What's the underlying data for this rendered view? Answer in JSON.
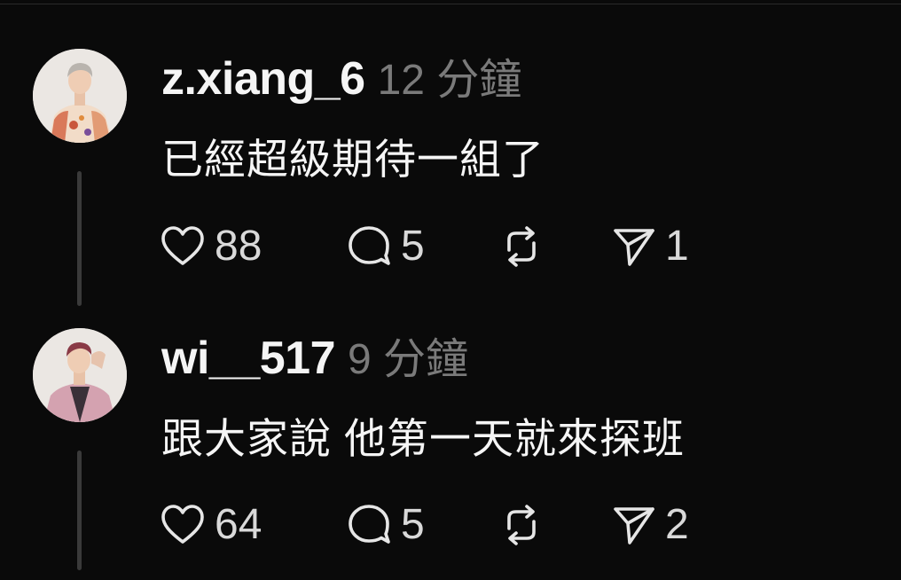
{
  "comments": [
    {
      "username": "z.xiang_6",
      "time": "12 分鐘",
      "text": "已經超級期待一組了",
      "likes": "88",
      "replies": "5",
      "shares": "1",
      "avatar_icon": "user-avatar-photo"
    },
    {
      "username": "wi__517",
      "time": "9 分鐘",
      "text": "跟大家說 他第一天就來探班",
      "likes": "64",
      "replies": "5",
      "shares": "2",
      "avatar_icon": "user-avatar-photo"
    }
  ],
  "icons": {
    "like": "heart-icon",
    "reply": "comment-bubble-icon",
    "repost": "repost-icon",
    "share": "send-icon"
  },
  "colors": {
    "background": "#0a0a0a",
    "text": "#f5f5f5",
    "muted": "#7a7a7a",
    "thread_line": "#3a3a3a"
  }
}
